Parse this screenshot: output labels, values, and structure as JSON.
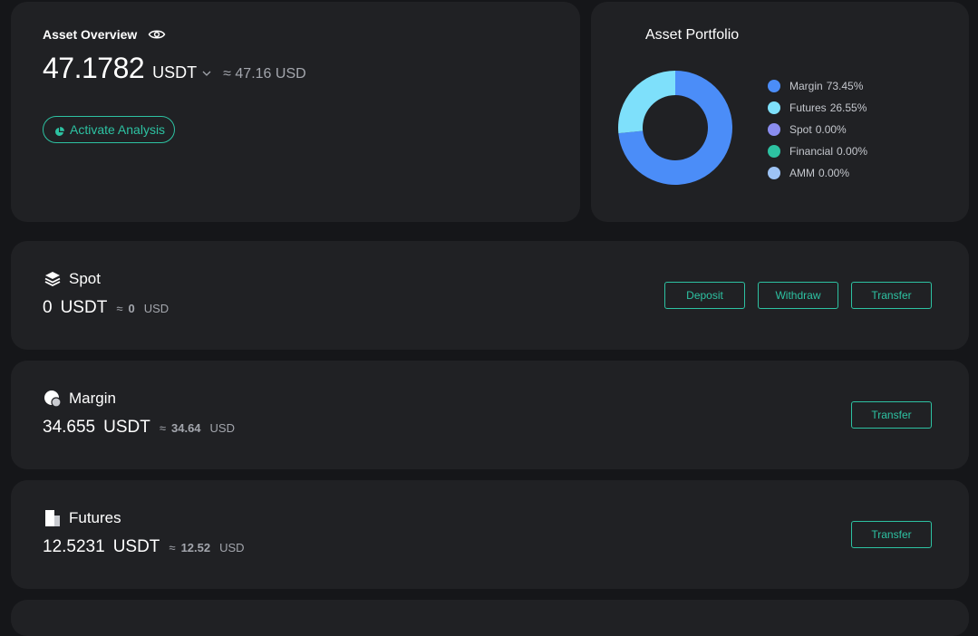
{
  "overview": {
    "title": "Asset Overview",
    "amount": "47.1782",
    "unit": "USDT",
    "approx": "≈ 47.16 USD",
    "activate_label": "Activate Analysis"
  },
  "portfolio": {
    "title": "Asset Portfolio",
    "legend": [
      {
        "name": "Margin",
        "pct": "73.45%",
        "color": "#4b8df8"
      },
      {
        "name": "Futures",
        "pct": "26.55%",
        "color": "#7ee0fb"
      },
      {
        "name": "Spot",
        "pct": "0.00%",
        "color": "#8a8df0"
      },
      {
        "name": "Financial",
        "pct": "0.00%",
        "color": "#2dc2a2"
      },
      {
        "name": "AMM",
        "pct": "0.00%",
        "color": "#9dc3f5"
      }
    ]
  },
  "chart_data": {
    "type": "pie",
    "categories": [
      "Margin",
      "Futures",
      "Spot",
      "Financial",
      "AMM"
    ],
    "values": [
      73.45,
      26.55,
      0.0,
      0.0,
      0.0
    ],
    "colors": [
      "#4b8df8",
      "#7ee0fb",
      "#8a8df0",
      "#2dc2a2",
      "#9dc3f5"
    ],
    "title": "Asset Portfolio",
    "donut": true,
    "legend": "right"
  },
  "accounts": {
    "spot": {
      "name": "Spot",
      "value": "0",
      "unit": "USDT",
      "approx_symbol": "≈",
      "approx_value": "0",
      "approx_unit": "USD",
      "deposit_label": "Deposit",
      "withdraw_label": "Withdraw",
      "transfer_label": "Transfer"
    },
    "margin": {
      "name": "Margin",
      "value": "34.655",
      "unit": "USDT",
      "approx_symbol": "≈",
      "approx_value": "34.64",
      "approx_unit": "USD",
      "transfer_label": "Transfer"
    },
    "futures": {
      "name": "Futures",
      "value": "12.5231",
      "unit": "USDT",
      "approx_symbol": "≈",
      "approx_value": "12.52",
      "approx_unit": "USD",
      "transfer_label": "Transfer"
    }
  },
  "colors": {
    "accent": "#2dc2a2",
    "card": "#202124",
    "background": "#151619"
  }
}
